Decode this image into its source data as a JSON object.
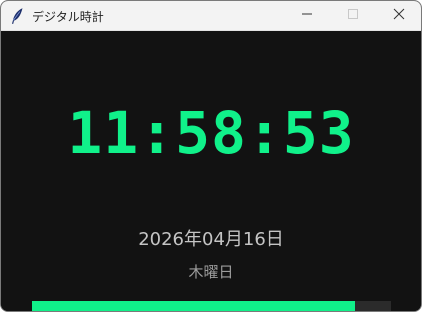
{
  "window": {
    "title": "デジタル時計",
    "app_icon": "feather-icon",
    "controls": [
      "minimize-icon",
      "maximize-icon",
      "close-icon"
    ]
  },
  "clock": {
    "time": "11:58:53",
    "date": "2026年04月16日",
    "weekday": "木曜日",
    "seconds_progress_fraction": 0.9
  },
  "colors": {
    "accent": "#10f18a",
    "background": "#121212",
    "date_text": "#c4c4c4",
    "weekday_text": "#9c9c9c",
    "progress_track": "#2b2b2b",
    "titlebar": "#f3f3f3"
  }
}
